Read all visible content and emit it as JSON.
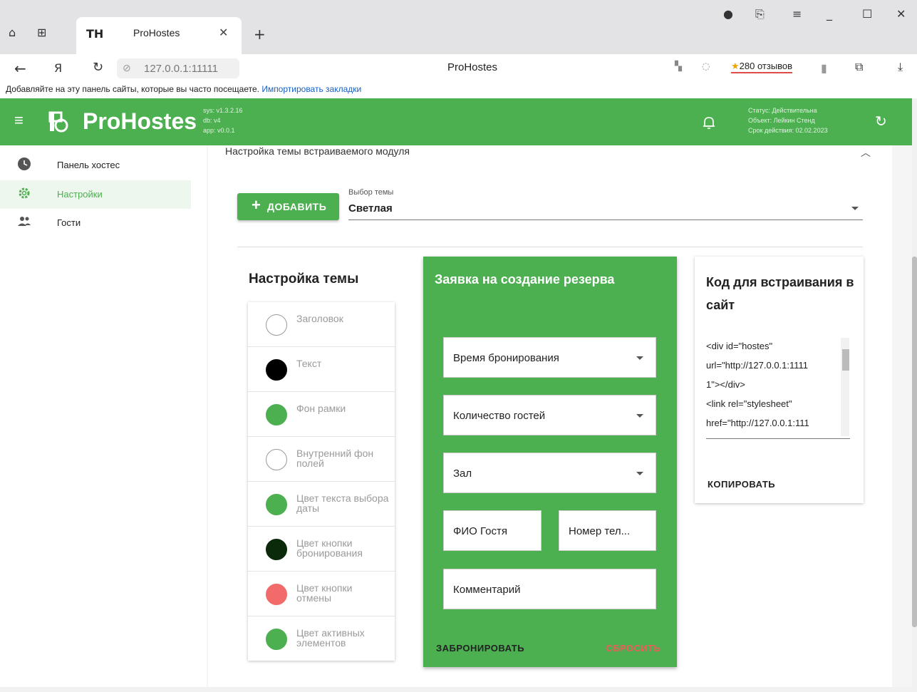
{
  "browser": {
    "tab_title": "ProHostes",
    "tab_favicon": "TH",
    "url": "127.0.0.1:11111",
    "page_title": "ProHostes",
    "reviews": "280 отзывов",
    "bookmarks_text": "Добавляйте на эту панель сайты, которые вы часто посещаете.",
    "bookmarks_link": "Импортировать закладки"
  },
  "header": {
    "brand": "ProHostes",
    "versions": [
      "sys: v1.3.2.16",
      "db: v4",
      "app: v0.0.1"
    ],
    "status_lines": [
      "Статус: Действительна",
      "Объект: Лейкин Стенд",
      "Срок действия: 02.02.2023"
    ]
  },
  "sidebar": {
    "items": [
      {
        "label": "Панель хостес",
        "icon": "clock-icon"
      },
      {
        "label": "Настройки",
        "icon": "gear-icon"
      },
      {
        "label": "Гости",
        "icon": "people-icon"
      }
    ]
  },
  "main": {
    "panel_title": "Настройка темы встраиваемого модуля",
    "add_label": "ДОБАВИТЬ",
    "theme_select_label": "Выбор темы",
    "theme_select_value": "Светлая"
  },
  "theme": {
    "heading": "Настройка темы",
    "items": [
      {
        "label": "Заголовок",
        "color": "#ffffff"
      },
      {
        "label": "Текст",
        "color": "#000000"
      },
      {
        "label": "Фон рамки",
        "color": "#4caf50"
      },
      {
        "label": "Внутренний фон полей",
        "color": "#ffffff"
      },
      {
        "label": "Цвет текста выбора даты",
        "color": "#4caf50"
      },
      {
        "label": "Цвет кнопки бронирования",
        "color": "#0a2a0a"
      },
      {
        "label": "Цвет кнопки отмены",
        "color": "#f26a6a"
      },
      {
        "label": "Цвет активных элементов",
        "color": "#4caf50"
      }
    ]
  },
  "booking": {
    "heading": "Заявка на создание резерва",
    "time": "Время бронирования",
    "guests": "Количество гостей",
    "hall": "Зал",
    "name": "ФИО Гостя",
    "phone": "Номер тел...",
    "comment": "Комментарий",
    "submit": "ЗАБРОНИРОВАТЬ",
    "reset": "СБРОСИТЬ"
  },
  "embed": {
    "heading": "Код для встраивания в сайт",
    "code_lines": [
      "<div id=\"hostes\"",
      "url=\"http://127.0.0.1:1111",
      "1\"></div>",
      "<link rel=\"stylesheet\"",
      "href=\"http://127.0.0.1:111"
    ],
    "copy": "КОПИРОВАТЬ"
  }
}
